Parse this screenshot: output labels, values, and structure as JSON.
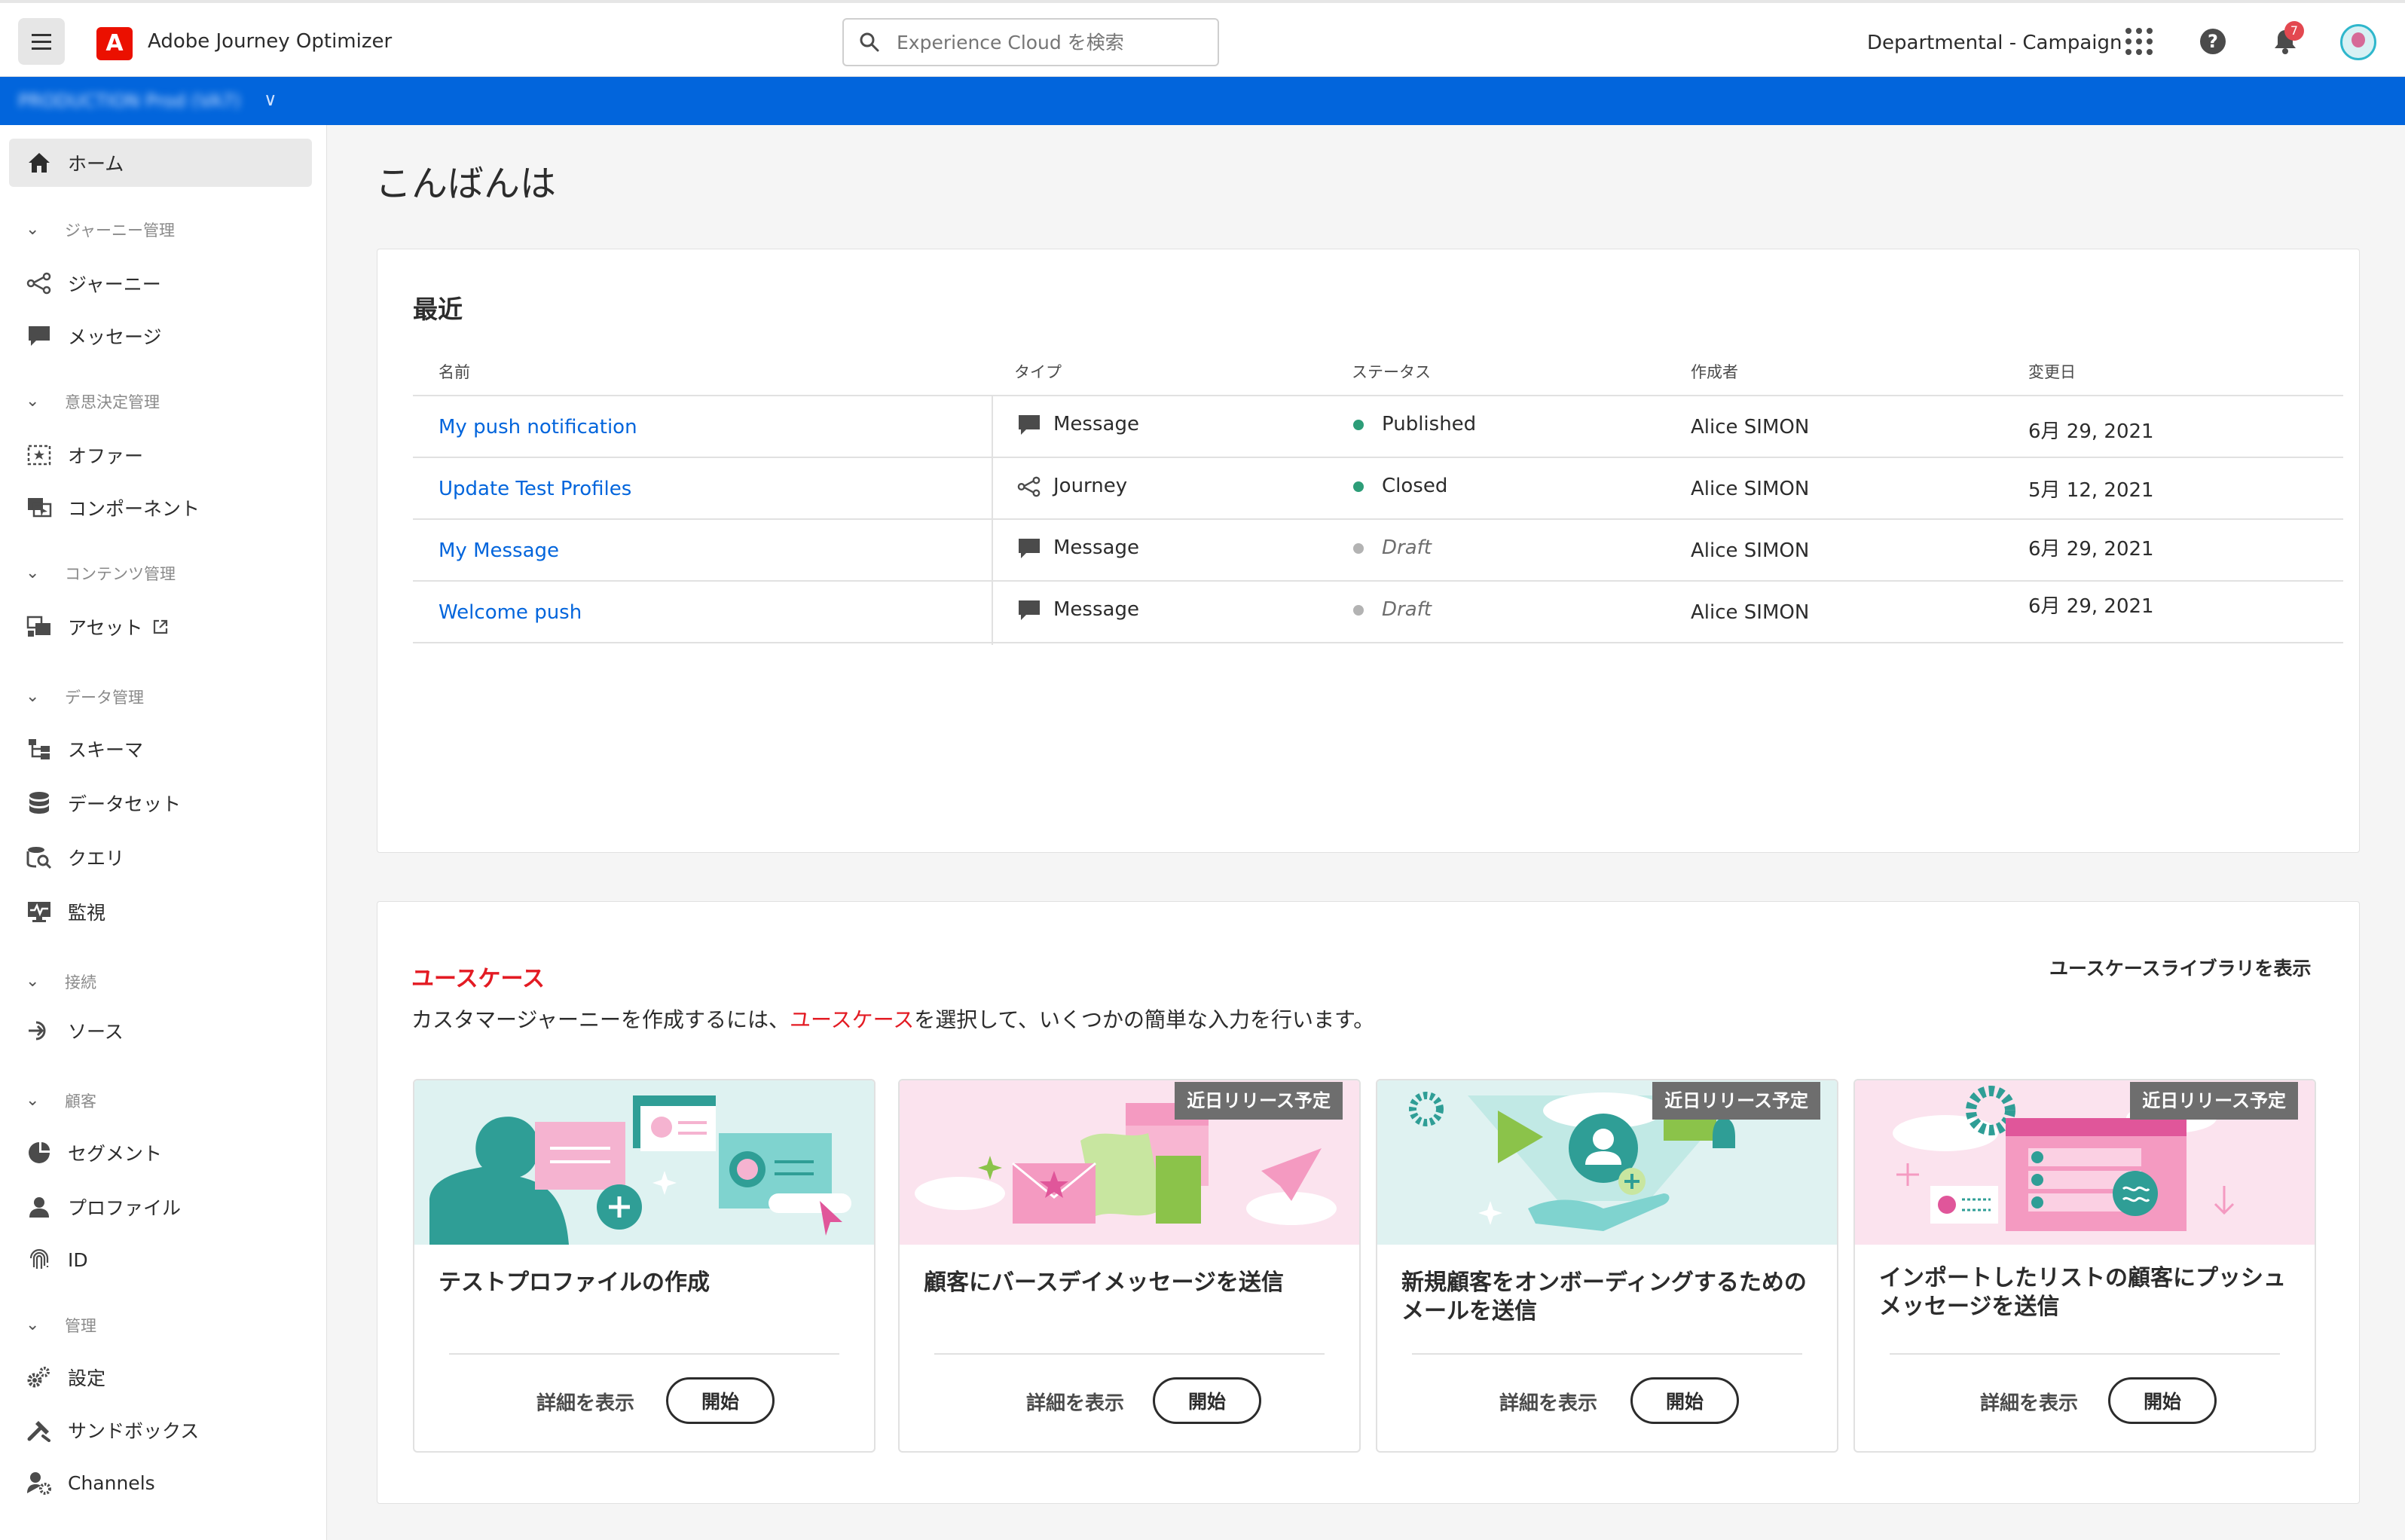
{
  "header": {
    "app_name": "Adobe Journey Optimizer",
    "adobe_logo": "A",
    "search_placeholder": "Experience Cloud を検索",
    "org_name": "Departmental - Campaign",
    "notification_count": "7",
    "help_label": "?"
  },
  "sandbox": {
    "label": "PRODUCTION Prod (VA7)",
    "chevron": "∨"
  },
  "sidebar": {
    "home": "ホーム",
    "groups": [
      {
        "label": "ジャーニー管理",
        "items": [
          "ジャーニー",
          "メッセージ"
        ]
      },
      {
        "label": "意思決定管理",
        "items": [
          "オファー",
          "コンポーネント"
        ]
      },
      {
        "label": "コンテンツ管理",
        "items": [
          "アセット"
        ]
      },
      {
        "label": "データ管理",
        "items": [
          "スキーマ",
          "データセット",
          "クエリ",
          "監視"
        ]
      },
      {
        "label": "接続",
        "items": [
          "ソース"
        ]
      },
      {
        "label": "顧客",
        "items": [
          "セグメント",
          "プロファイル",
          "ID"
        ]
      },
      {
        "label": "管理",
        "items": [
          "設定",
          "サンドボックス",
          "Channels"
        ]
      }
    ]
  },
  "greeting": "こんばんは",
  "recent": {
    "title": "最近",
    "columns": [
      "名前",
      "タイプ",
      "ステータス",
      "作成者",
      "変更日"
    ],
    "rows": [
      {
        "name": "My push notification",
        "type": "Message",
        "status": "Published",
        "author": "Alice SIMON",
        "date": "6月 29, 2021"
      },
      {
        "name": "Update Test Profiles",
        "type": "Journey",
        "status": "Closed",
        "author": "Alice SIMON",
        "date": "5月 12, 2021"
      },
      {
        "name": "My Message",
        "type": "Message",
        "status": "Draft",
        "author": "Alice SIMON",
        "date": "6月 29, 2021"
      },
      {
        "name": "Welcome push",
        "type": "Message",
        "status": "Draft",
        "author": "Alice SIMON",
        "date": "6月 29, 2021"
      }
    ]
  },
  "usecases": {
    "title": "ユースケース",
    "desc_before": "カスタマージャーニーを作成するには、",
    "desc_highlight": "ユースケース",
    "desc_after": "を選択して、いくつかの簡単な入力を行います。",
    "library_link": "ユースケースライブラリを表示",
    "details_label": "詳細を表示",
    "start_label": "開始",
    "coming_soon": "近日リリース予定",
    "cards": [
      {
        "title": "テストプロファイルの作成"
      },
      {
        "title": "顧客にバースデイメッセージを送信"
      },
      {
        "title": "新規顧客をオンボーディングするためのメールを送信"
      },
      {
        "title": "インポートしたリストの顧客にプッシュメッセージを送信"
      }
    ]
  },
  "colors": {
    "brand_blue": "#0265dc",
    "adobe_red": "#eb1000",
    "usecase_red": "#e31b23",
    "status_published": "#2d9d78",
    "status_closed": "#2d9d78",
    "status_draft": "#b3b3b3"
  }
}
